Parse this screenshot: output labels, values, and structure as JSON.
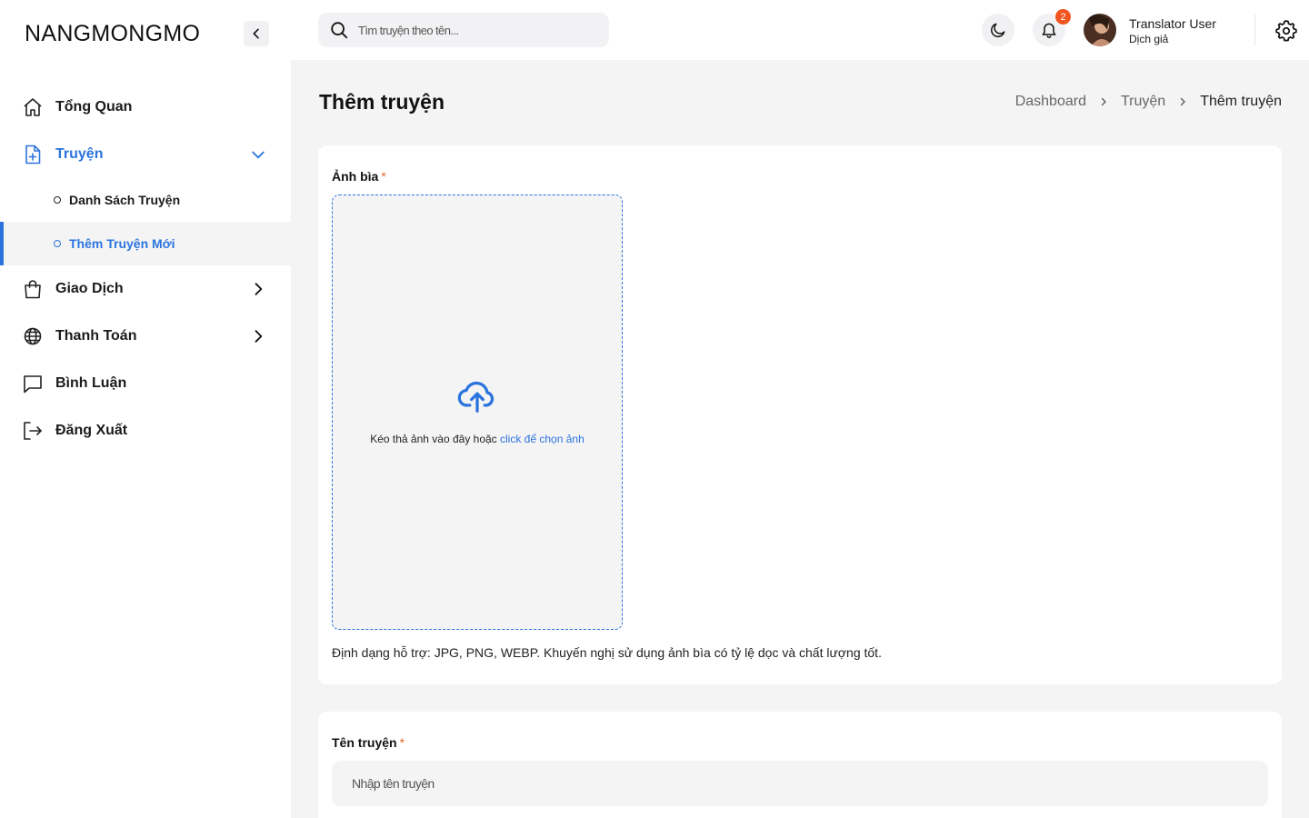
{
  "brand": {
    "logo": "NANGMONGMO"
  },
  "header": {
    "search_placeholder": "Tìm truyện theo tên...",
    "notification_count": "2",
    "user_name": "Translator User",
    "user_role": "Dịch giả"
  },
  "sidebar": {
    "items": [
      {
        "label": "Tổng Quan",
        "icon": "home-icon"
      },
      {
        "label": "Truyện",
        "icon": "file-plus-icon",
        "expanded": true
      },
      {
        "label": "Giao Dịch",
        "icon": "shopping-bag-icon"
      },
      {
        "label": "Thanh Toán",
        "icon": "globe-icon"
      },
      {
        "label": "Bình Luận",
        "icon": "comment-icon"
      },
      {
        "label": "Đăng Xuất",
        "icon": "logout-icon"
      }
    ],
    "subitems": [
      {
        "label": "Danh Sách Truyện"
      },
      {
        "label": "Thêm Truyện Mới",
        "current": true
      }
    ]
  },
  "page": {
    "title": "Thêm truyện",
    "breadcrumb": [
      "Dashboard",
      "Truyện",
      "Thêm truyện"
    ]
  },
  "cover": {
    "label": "Ảnh bìa",
    "required_mark": "*",
    "drop_text": "Kéo thả ảnh vào đây hoặc ",
    "drop_link": "click để chọn ảnh",
    "hint": "Định dạng hỗ trợ: JPG, PNG, WEBP. Khuyến nghị sử dụng ảnh bìa có tỷ lệ dọc và chất lượng tốt."
  },
  "name_field": {
    "label": "Tên truyện",
    "required_mark": "*",
    "placeholder": "Nhập tên truyện"
  },
  "colors": {
    "accent": "#2b74de",
    "badge": "#f1541f",
    "required": "#e06b2a",
    "background": "#f4f4f5"
  }
}
